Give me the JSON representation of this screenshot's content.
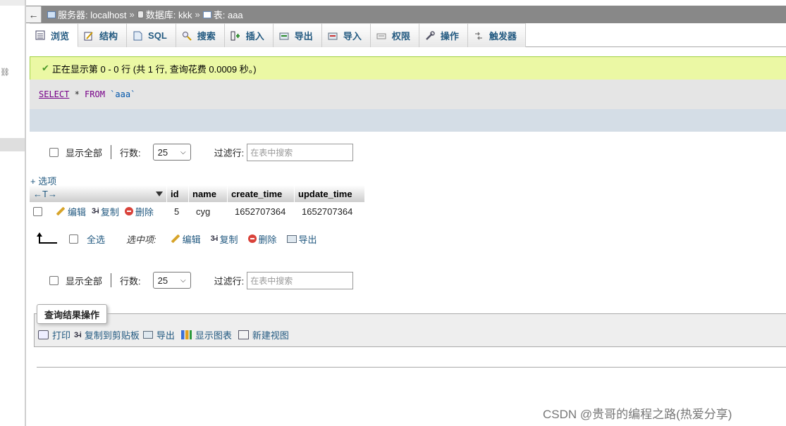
{
  "breadcrumb": {
    "back": "←",
    "server": "服务器: localhost",
    "database": "数据库: kkk",
    "table": "表: aaa",
    "separator": "»"
  },
  "tabs": [
    {
      "label": "浏览",
      "icon": "browse-icon"
    },
    {
      "label": "结构",
      "icon": "structure-icon"
    },
    {
      "label": "SQL",
      "icon": "sql-icon"
    },
    {
      "label": "搜索",
      "icon": "search-icon"
    },
    {
      "label": "插入",
      "icon": "insert-icon"
    },
    {
      "label": "导出",
      "icon": "export-icon"
    },
    {
      "label": "导入",
      "icon": "import-icon"
    },
    {
      "label": "权限",
      "icon": "privileges-icon"
    },
    {
      "label": "操作",
      "icon": "wrench-icon"
    },
    {
      "label": "触发器",
      "icon": "triggers-icon"
    }
  ],
  "message": {
    "text": "正在显示第 0 - 0 行 (共 1 行, 查询花费 0.0009 秒。)"
  },
  "sql": {
    "select": "SELECT",
    "star": " * ",
    "from": "FROM",
    "table": " `aaa`"
  },
  "nav": {
    "show_all": "显示全部",
    "rows_label": "行数:",
    "rows_value": "25",
    "filter_label": "过滤行:",
    "filter_placeholder": "在表中搜索"
  },
  "options_link": "+ 选项",
  "table": {
    "arrows": "←T→",
    "columns": [
      "id",
      "name",
      "create_time",
      "update_time"
    ],
    "rows": [
      {
        "id": "5",
        "name": "cyg",
        "create_time": "1652707364",
        "update_time": "1652707364"
      }
    ],
    "row_actions": {
      "edit": "编辑",
      "copy": "复制",
      "delete": "删除"
    }
  },
  "bulk": {
    "check_all": "全选",
    "with_selected": "选中项:",
    "edit": "编辑",
    "copy": "复制",
    "delete": "删除",
    "export": "导出"
  },
  "query_ops": {
    "legend": "查询结果操作",
    "print": "打印",
    "copy_clipboard": "复制到剪贴板",
    "export": "导出",
    "display_chart": "显示图表",
    "create_view": "新建视图"
  },
  "watermark": "CSDN @贵哥的编程之路(热爱分享)"
}
